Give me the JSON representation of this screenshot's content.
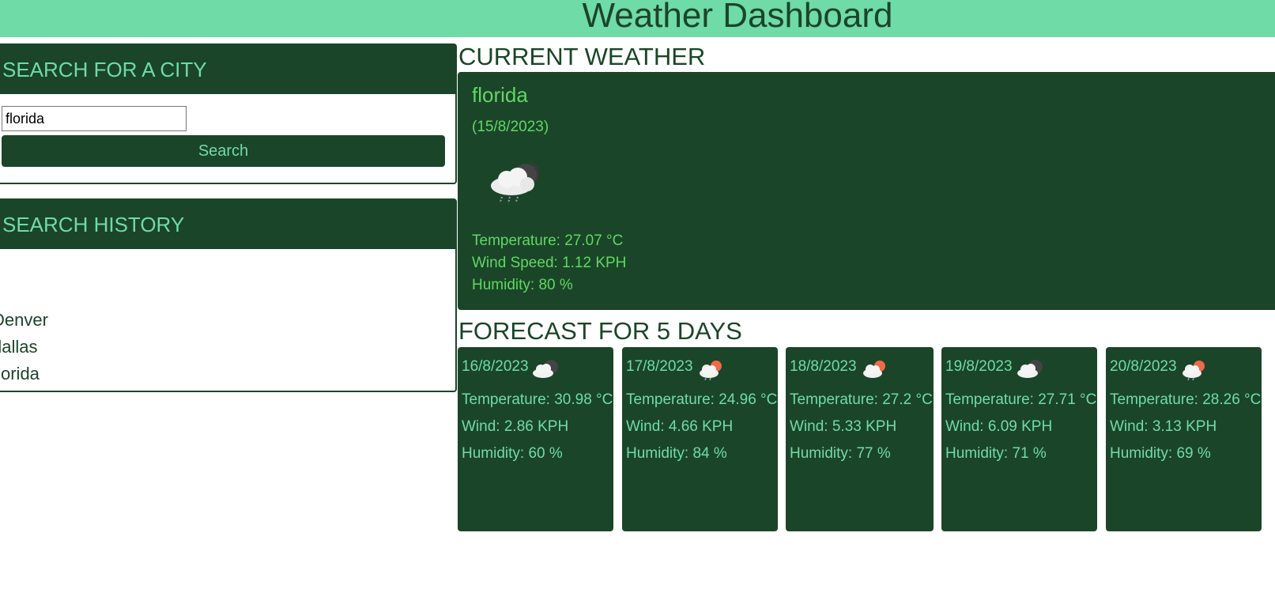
{
  "header": {
    "title": "Weather Dashboard"
  },
  "search": {
    "heading": "SEARCH FOR A CITY",
    "input_value": "florida",
    "button_label": "Search"
  },
  "history": {
    "heading": "SEARCH HISTORY",
    "items": [
      "Denver",
      "dallas",
      "florida"
    ]
  },
  "current": {
    "heading": "CURRENT WEATHER",
    "city": "florida",
    "date": "(15/8/2023)",
    "icon": "rain-cloud-night-icon",
    "temperature": "Temperature: 27.07 °C",
    "wind": "Wind Speed: 1.12 KPH",
    "humidity": "Humidity: 80 %"
  },
  "forecast": {
    "heading": "FORECAST FOR 5 DAYS",
    "days": [
      {
        "date": "16/8/2023",
        "icon": "cloud-night-icon",
        "temperature": "Temperature: 30.98 °C",
        "wind": "Wind: 2.86 KPH",
        "humidity": "Humidity: 60 %"
      },
      {
        "date": "17/8/2023",
        "icon": "cloud-sun-icon",
        "temperature": "Temperature: 24.96 °C",
        "wind": "Wind: 4.66 KPH",
        "humidity": "Humidity: 84 %"
      },
      {
        "date": "18/8/2023",
        "icon": "cloud-sun-icon",
        "temperature": "Temperature: 27.2 °C",
        "wind": "Wind: 5.33 KPH",
        "humidity": "Humidity: 77 %"
      },
      {
        "date": "19/8/2023",
        "icon": "cloud-night-icon",
        "temperature": "Temperature: 27.71 °C",
        "wind": "Wind: 6.09 KPH",
        "humidity": "Humidity: 71 %"
      },
      {
        "date": "20/8/2023",
        "icon": "cloud-sun-icon",
        "temperature": "Temperature: 28.26 °C",
        "wind": "Wind: 3.13 KPH",
        "humidity": "Humidity: 69 %"
      }
    ]
  },
  "colors": {
    "header_bg": "#6fdba7",
    "panel_dark": "#1b4528",
    "accent_text": "#6fdba7",
    "current_text": "#5fd765"
  }
}
